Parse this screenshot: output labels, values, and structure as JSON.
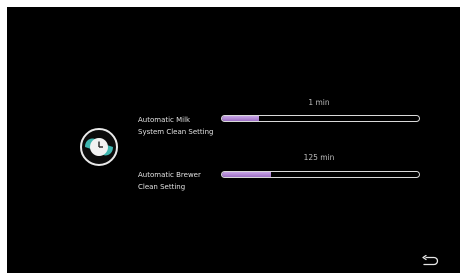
{
  "settings": [
    {
      "label_line1": "Automatic Milk",
      "label_line2": "System Clean Setting",
      "value": "1 min",
      "level": 0.19
    },
    {
      "label_line1": "Automatic Brewer",
      "label_line2": "Clean Setting",
      "value": "125 min",
      "level": 0.25
    }
  ],
  "icons": {
    "settings_icon": "clock-icon",
    "back_icon": "back-arrow-icon"
  },
  "colors": {
    "background": "#000000",
    "slider_fill": "#b48ad6",
    "icon_teal": "#3fb6b0"
  }
}
